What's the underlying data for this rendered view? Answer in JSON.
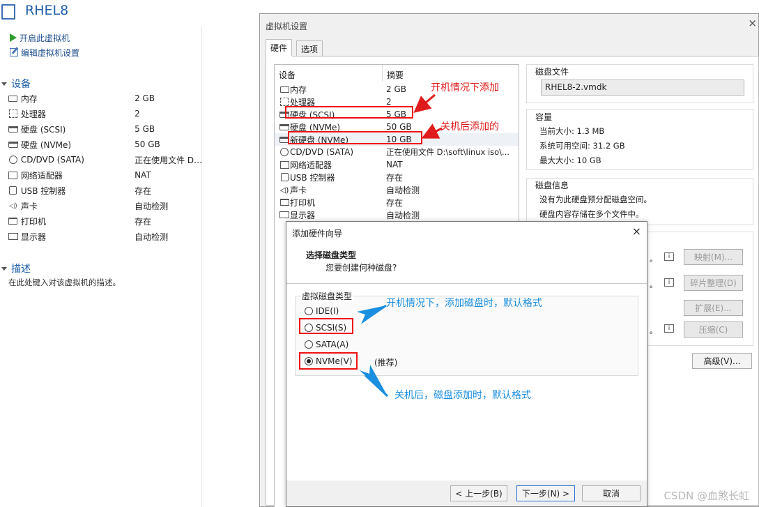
{
  "vm": {
    "title": "RHEL8",
    "actions": [
      "开启此虚拟机",
      "编辑虚拟机设置"
    ],
    "devices_header": "设备",
    "devices": [
      {
        "icon": "memory-icon",
        "name": "内存",
        "value": "2 GB"
      },
      {
        "icon": "cpu-icon",
        "name": "处理器",
        "value": "2"
      },
      {
        "icon": "disk-icon",
        "name": "硬盘 (SCSI)",
        "value": "5 GB"
      },
      {
        "icon": "disk-icon",
        "name": "硬盘 (NVMe)",
        "value": "50 GB"
      },
      {
        "icon": "cd-icon",
        "name": "CD/DVD (SATA)",
        "value": "正在使用文件 D:..."
      },
      {
        "icon": "network-icon",
        "name": "网络适配器",
        "value": "NAT"
      },
      {
        "icon": "usb-icon",
        "name": "USB 控制器",
        "value": "存在"
      },
      {
        "icon": "speaker-icon",
        "name": "声卡",
        "value": "自动检测"
      },
      {
        "icon": "printer-icon",
        "name": "打印机",
        "value": "存在"
      },
      {
        "icon": "monitor-icon",
        "name": "显示器",
        "value": "自动检测"
      }
    ],
    "description_header": "描述",
    "description_placeholder": "在此处键入对该虚拟机的描述。"
  },
  "settings": {
    "title": "虚拟机设置",
    "close": "×",
    "tabs": [
      "硬件",
      "选项"
    ],
    "list_headers": [
      "设备",
      "摘要"
    ],
    "list": [
      {
        "icon": "memory-icon",
        "name": "内存",
        "value": "2 GB"
      },
      {
        "icon": "cpu-icon",
        "name": "处理器",
        "value": "2"
      },
      {
        "icon": "disk-icon",
        "name": "硬盘 (SCSI)",
        "value": "5 GB"
      },
      {
        "icon": "disk-icon",
        "name": "硬盘 (NVMe)",
        "value": "50 GB"
      },
      {
        "icon": "disk-icon",
        "name": "新硬盘 (NVMe)",
        "value": "10 GB"
      },
      {
        "icon": "cd-icon",
        "name": "CD/DVD (SATA)",
        "value": "正在使用文件 D:\\soft\\linux iso\\..."
      },
      {
        "icon": "network-icon",
        "name": "网络适配器",
        "value": "NAT"
      },
      {
        "icon": "usb-icon",
        "name": "USB 控制器",
        "value": "存在"
      },
      {
        "icon": "speaker-icon",
        "name": "声卡",
        "value": "自动检测"
      },
      {
        "icon": "printer-icon",
        "name": "打印机",
        "value": "存在"
      },
      {
        "icon": "monitor-icon",
        "name": "显示器",
        "value": "自动检测"
      }
    ],
    "disk_file_label": "磁盘文件",
    "disk_file_value": "RHEL8-2.vmdk",
    "capacity_label": "容量",
    "current_size": "当前大小: 1.3 MB",
    "available_space": "系统可用空间: 31.2 GB",
    "max_size": "最大大小: 10 GB",
    "disk_info_label": "磁盘信息",
    "disk_info_1": "没有为此硬盘预分配磁盘空间。",
    "disk_info_2": "硬盘内容存储在多个文件中。",
    "buttons": {
      "map": "映射(M)...",
      "defrag": "碎片整理(D)",
      "expand": "扩展(E)...",
      "compact": "压缩(C)",
      "advanced": "高级(V)..."
    },
    "dot": "。"
  },
  "wizard": {
    "title": "添加硬件向导",
    "close": "×",
    "heading": "选择磁盘类型",
    "subheading": "您要创建何种磁盘?",
    "group_label": "虚拟磁盘类型",
    "options": [
      {
        "label": "IDE(I)",
        "selected": false
      },
      {
        "label": "SCSI(S)",
        "selected": false
      },
      {
        "label": "SATA(A)",
        "selected": false
      },
      {
        "label": "NVMe(V)",
        "selected": true
      }
    ],
    "recommended": "(推荐)",
    "back": "< 上一步(B)",
    "next": "下一步(N) >",
    "cancel": "取消"
  },
  "annotations": {
    "powered_on_added": "开机情况下添加",
    "powered_off_added": "关机后添加的",
    "default_when_on": "开机情况下，添加磁盘时，默认格式",
    "default_when_off": "关机后，磁盘添加时，默认格式",
    "red": "#e01b1b",
    "blue": "#1a8fe0"
  },
  "watermark": "CSDN @血煞长虹"
}
